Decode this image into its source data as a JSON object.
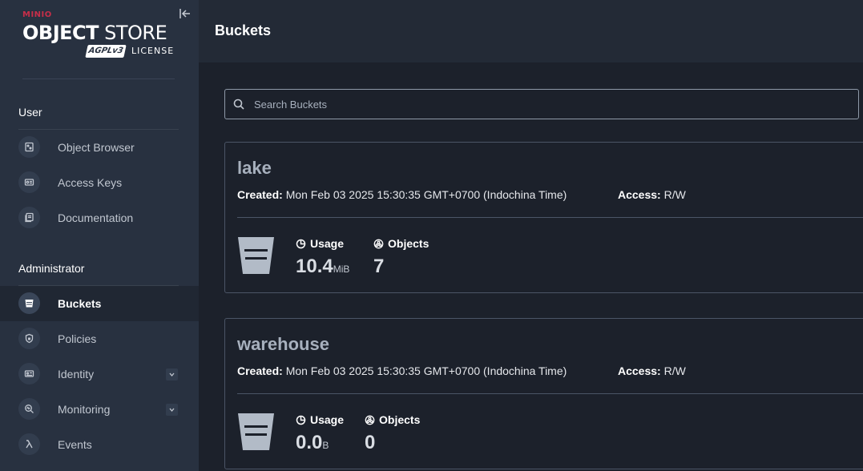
{
  "brand": {
    "top": "MINIO",
    "main_bold": "OBJECT",
    "main_rest": " STORE",
    "badge": "AGPLv3",
    "license": "LICENSE"
  },
  "sidebar": {
    "user_title": "User",
    "user_items": [
      {
        "label": "Object Browser",
        "icon": "object-browser-icon"
      },
      {
        "label": "Access Keys",
        "icon": "access-keys-icon"
      },
      {
        "label": "Documentation",
        "icon": "documentation-icon"
      }
    ],
    "admin_title": "Administrator",
    "admin_items": [
      {
        "label": "Buckets",
        "icon": "bucket-icon",
        "active": true
      },
      {
        "label": "Policies",
        "icon": "policy-shield-icon"
      },
      {
        "label": "Identity",
        "icon": "identity-card-icon",
        "expandable": true
      },
      {
        "label": "Monitoring",
        "icon": "monitoring-icon",
        "expandable": true
      },
      {
        "label": "Events",
        "icon": "lambda-icon"
      }
    ]
  },
  "header": {
    "title": "Buckets"
  },
  "search": {
    "placeholder": "Search Buckets",
    "value": ""
  },
  "buckets": [
    {
      "name": "lake",
      "created_label": "Created:",
      "created": "Mon Feb 03 2025 15:30:35 GMT+0700 (Indochina Time)",
      "access_label": "Access:",
      "access": "R/W",
      "usage_label": "Usage",
      "usage_value": "10.4",
      "usage_unit": "MiB",
      "objects_label": "Objects",
      "objects_value": "7"
    },
    {
      "name": "warehouse",
      "created_label": "Created:",
      "created": "Mon Feb 03 2025 15:30:35 GMT+0700 (Indochina Time)",
      "access_label": "Access:",
      "access": "R/W",
      "usage_label": "Usage",
      "usage_value": "0.0",
      "usage_unit": "B",
      "objects_label": "Objects",
      "objects_value": "0"
    }
  ],
  "colors": {
    "sidebar_bg": "#283140",
    "main_bg": "#1c212b",
    "header_bg": "#232a36",
    "brand_accent": "#c72e49"
  }
}
